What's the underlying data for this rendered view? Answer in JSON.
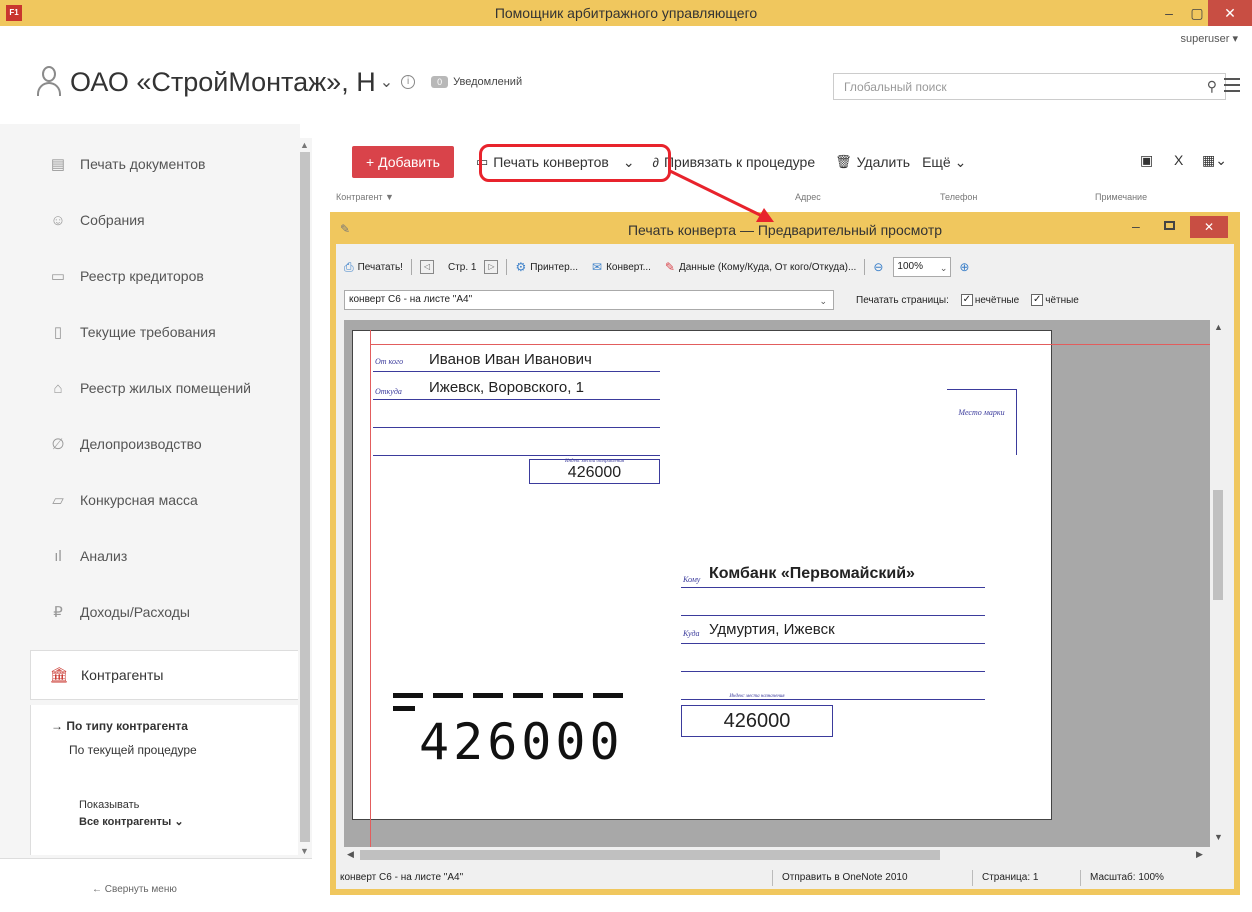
{
  "window": {
    "title": "Помощник арбитражного управляющего",
    "app_icon": "F1",
    "minimize": "–",
    "maximize": "▢",
    "close": "✕"
  },
  "user": {
    "name": "superuser ▾"
  },
  "header": {
    "org_name": "ОАО «СтройМонтаж», Н",
    "chevron": "⌄",
    "info": "i",
    "notif_count": "0",
    "notif_label": "Уведомлений",
    "search_placeholder": "Глобальный поиск"
  },
  "sidebar": {
    "items": [
      {
        "label": "Печать документов",
        "icon": "document-icon"
      },
      {
        "label": "Собрания",
        "icon": "meeting-icon"
      },
      {
        "label": "Реестр кредиторов",
        "icon": "register-icon"
      },
      {
        "label": "Текущие требования",
        "icon": "phone-icon"
      },
      {
        "label": "Реестр жилых помещений",
        "icon": "house-icon"
      },
      {
        "label": "Делопроизводство",
        "icon": "paperclip-icon"
      },
      {
        "label": "Конкурсная масса",
        "icon": "box-icon"
      },
      {
        "label": "Анализ",
        "icon": "chart-icon"
      },
      {
        "label": "Доходы/Расходы",
        "icon": "ruble-icon"
      },
      {
        "label": "Контрагенты",
        "icon": "bank-icon",
        "active": true
      }
    ],
    "sub_items": [
      "→ По типу контрагента",
      "По текущей процедуре"
    ],
    "show_label": "Показывать",
    "show_value": "Все контрагенты ⌄",
    "collapse": "←  Свернуть меню"
  },
  "toolbar": {
    "add": "+ Добавить",
    "print_envelopes": "Печать конвертов",
    "attach": "Привязать к процедуре",
    "delete": "Удалить",
    "more": "Ещё ⌄",
    "export_x": "X"
  },
  "columns": {
    "kontragent": "Контрагент ▼",
    "address": "Адрес",
    "phone": "Телефон",
    "note": "Примечание"
  },
  "dialog": {
    "title": "Печать конверта — Предварительный просмотр",
    "toolbar": {
      "print": "Печатать!",
      "page": "Стр. 1",
      "printer": "Принтер...",
      "envelope": "Конверт...",
      "data": "Данные (Кому/Куда, От кого/Откуда)...",
      "zoom": "100%"
    },
    "envelope_select": "конверт С6 - на листе \"А4\"",
    "print_pages_label": "Печатать страницы:",
    "odd": "нечётные",
    "even": "чётные",
    "status": {
      "format": "конверт С6 - на листе \"А4\"",
      "send": "Отправить в OneNote 2010",
      "page": "Страница: 1",
      "scale": "Масштаб: 100%"
    }
  },
  "envelope": {
    "from_label": "От кого",
    "from_value": "Иванов Иван Иванович",
    "from_addr_label": "Откуда",
    "from_addr_value": "Ижевск, Воровского, 1",
    "stamp": "Место марки",
    "sender_index_caption": "Индекс места отправления",
    "sender_index": "426000",
    "to_label": "Кому",
    "to_value": "Комбанк «Первомайский»",
    "to_addr_label": "Куда",
    "to_addr_value": "Удмуртия, Ижевск",
    "dest_index_caption": "Индекс места назначения",
    "dest_index": "426000",
    "big_index": "426000"
  },
  "colors": {
    "titlebar": "#f0c75e",
    "accent_red": "#d9434a",
    "envelope_blue": "#3b3b9c",
    "annotation": "#e8232c"
  }
}
